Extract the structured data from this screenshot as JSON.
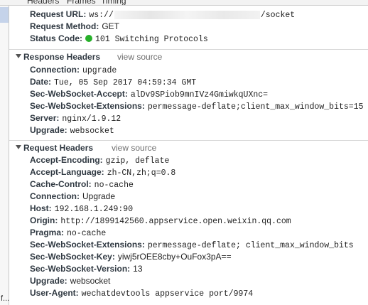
{
  "tabs": [
    "Headers",
    "Frames",
    "Timing"
  ],
  "left_fragment": "f...",
  "general": [
    {
      "key": "Request URL:",
      "prefix": "ws://",
      "suffix": "/socket"
    },
    {
      "key": "Request Method:",
      "value": "GET"
    },
    {
      "key": "Status Code:",
      "value": "101 Switching Protocols",
      "status_color": "#27b02a"
    }
  ],
  "response_headers": {
    "title": "Response Headers",
    "view_source": "view source",
    "rows": [
      {
        "key": "Connection:",
        "value": "upgrade"
      },
      {
        "key": "Date:",
        "value": "Tue, 05 Sep 2017 04:59:34 GMT"
      },
      {
        "key": "Sec-WebSocket-Accept:",
        "value": "alDv9SPiob9mnIVz4GmiwkqUXnc="
      },
      {
        "key": "Sec-WebSocket-Extensions:",
        "value": "permessage-deflate;client_max_window_bits=15"
      },
      {
        "key": "Server:",
        "value": "nginx/1.9.12"
      },
      {
        "key": "Upgrade:",
        "value": "websocket"
      }
    ]
  },
  "request_headers": {
    "title": "Request Headers",
    "view_source": "view source",
    "rows": [
      {
        "key": "Accept-Encoding:",
        "value": "gzip, deflate"
      },
      {
        "key": "Accept-Language:",
        "value": "zh-CN,zh;q=0.8"
      },
      {
        "key": "Cache-Control:",
        "value": "no-cache"
      },
      {
        "key": "Connection:",
        "value": "Upgrade"
      },
      {
        "key": "Host:",
        "value": "192.168.1.249:90"
      },
      {
        "key": "Origin:",
        "value": "http://1899142560.appservice.open.weixin.qq.com"
      },
      {
        "key": "Pragma:",
        "value": "no-cache"
      },
      {
        "key": "Sec-WebSocket-Extensions:",
        "value": "permessage-deflate; client_max_window_bits"
      },
      {
        "key": "Sec-WebSocket-Key:",
        "value": "yiwj5rOEE8cby+OuFox3pA=="
      },
      {
        "key": "Sec-WebSocket-Version:",
        "value": "13"
      },
      {
        "key": "Upgrade:",
        "value": "websocket"
      },
      {
        "key": "User-Agent:",
        "value": "wechatdevtools appservice port/9974"
      }
    ]
  }
}
